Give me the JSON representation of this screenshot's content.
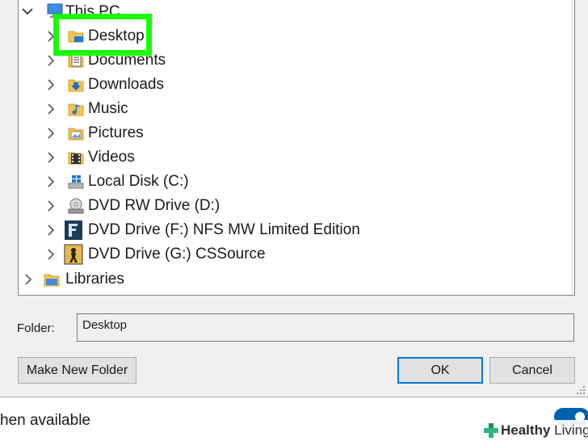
{
  "tree": {
    "root": {
      "label": "This PC",
      "icon": "computer-icon",
      "expanded": true
    },
    "items": [
      {
        "label": "Desktop",
        "icon": "desktop-folder-icon",
        "highlighted": true
      },
      {
        "label": "Documents",
        "icon": "documents-folder-icon"
      },
      {
        "label": "Downloads",
        "icon": "downloads-folder-icon"
      },
      {
        "label": "Music",
        "icon": "music-folder-icon"
      },
      {
        "label": "Pictures",
        "icon": "pictures-folder-icon"
      },
      {
        "label": "Videos",
        "icon": "videos-folder-icon"
      },
      {
        "label": "Local Disk (C:)",
        "icon": "windows-drive-icon"
      },
      {
        "label": "DVD RW Drive (D:)",
        "icon": "dvd-drive-icon"
      },
      {
        "label": "DVD Drive (F:) NFS MW Limited Edition",
        "icon": "nfs-disc-icon"
      },
      {
        "label": "DVD Drive (G:) CSSource",
        "icon": "cssource-disc-icon"
      }
    ],
    "libraries": {
      "label": "Libraries",
      "icon": "libraries-folder-icon"
    }
  },
  "folder": {
    "label": "Folder:",
    "value": "Desktop"
  },
  "buttons": {
    "new_folder": "Make New Folder",
    "ok": "OK",
    "cancel": "Cancel"
  },
  "background": {
    "text": "hen available",
    "toggle_on": true
  },
  "watermark": {
    "bold": "Healthy",
    "light": "Living"
  },
  "colors": {
    "highlight": "#1aff00",
    "accent": "#0078d7",
    "toggle": "#0063b1"
  }
}
